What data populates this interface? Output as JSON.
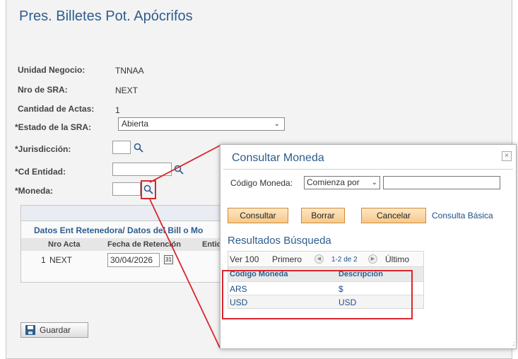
{
  "page": {
    "title": "Pres. Billetes Pot. Apócrifos",
    "fields": {
      "unidad_negocio_label": "Unidad Negocio:",
      "unidad_negocio_value": "TNNAA",
      "nro_sra_label": "Nro de SRA:",
      "nro_sra_value": "NEXT",
      "cantidad_actas_label": "Cantidad de Actas:",
      "cantidad_actas_value": "1",
      "estado_label": "*Estado de la SRA:",
      "estado_value": "Abierta",
      "jurisdiccion_label": "*Jurisdicción:",
      "cd_entidad_label": "*Cd Entidad:",
      "moneda_label": "*Moneda:"
    },
    "grid": {
      "title": "Datos Ent Retenedora/ Datos del Bill o Mo",
      "headers": [
        "Nro Acta",
        "Fecha de Retención",
        "Entida"
      ],
      "rows": [
        {
          "num": "1",
          "nro_acta": "NEXT",
          "fecha": "30/04/2026"
        }
      ],
      "calendar_glyph": "31"
    },
    "save_label": "Guardar"
  },
  "modal": {
    "title": "Consultar Moneda",
    "close_glyph": "×",
    "filter_label": "Código Moneda:",
    "operator_value": "Comienza por",
    "chevron": "⌄",
    "buttons": {
      "consultar": "Consultar",
      "borrar": "Borrar",
      "cancelar": "Cancelar"
    },
    "basic_link": "Consulta Básica",
    "results_title": "Resultados Búsqueda",
    "nav": {
      "ver": "Ver 100",
      "primero": "Primero",
      "range": "1-2 de 2",
      "ultimo": "Último",
      "prev_glyph": "◀",
      "next_glyph": "▶"
    },
    "columns": [
      "Código Moneda",
      "Descripción"
    ],
    "rows": [
      {
        "codigo": "ARS",
        "descripcion": "$"
      },
      {
        "codigo": "USD",
        "descripcion": "USD"
      }
    ],
    "grip": ".:"
  },
  "colors": {
    "accent": "#2e5d8e",
    "highlight": "#d9262c",
    "button_orange": "#f6c98a"
  }
}
